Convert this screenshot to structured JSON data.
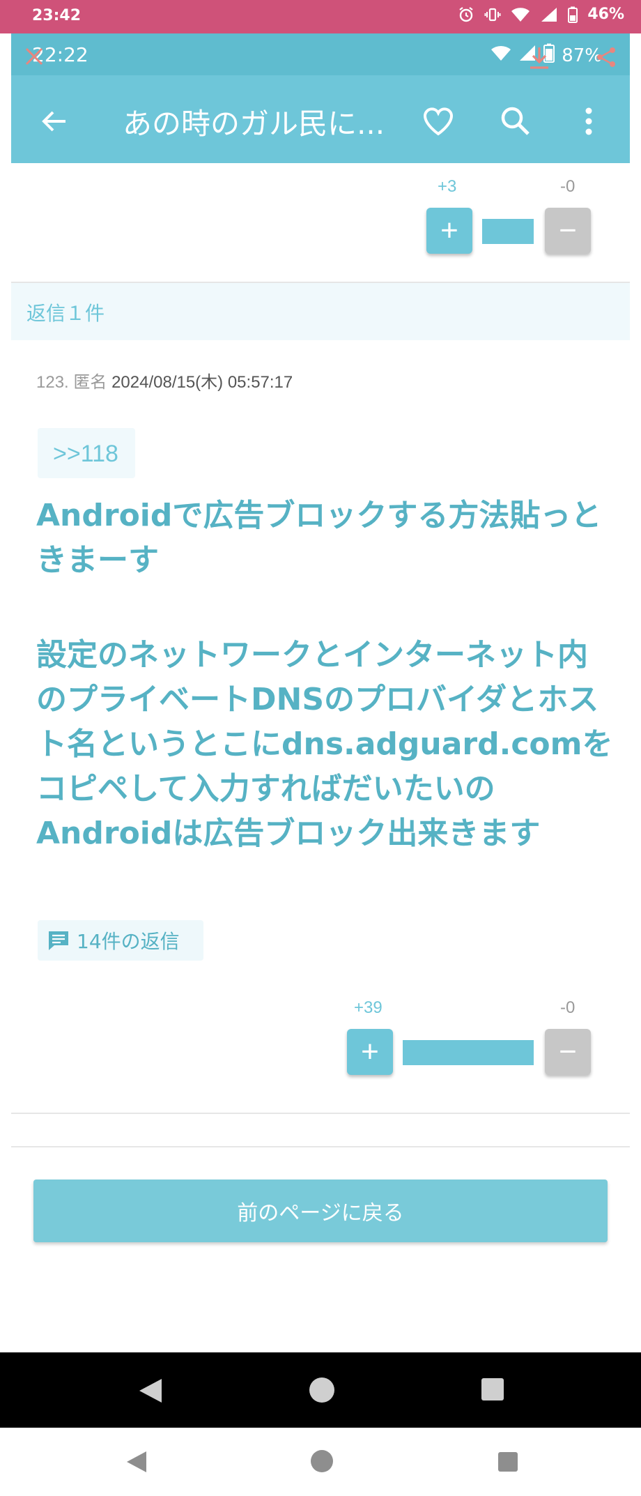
{
  "outer_status": {
    "time": "23:42",
    "battery": "46%"
  },
  "inner_status": {
    "time": "22:22",
    "battery": "87%"
  },
  "appbar": {
    "title": "あの時のガル民に..."
  },
  "prev_vote": {
    "plus_count": "+3",
    "minus_count": "-0",
    "plus_label": "+",
    "minus_label": "−",
    "ratio": 1.0
  },
  "reply_header": {
    "label": "返信１件"
  },
  "comment": {
    "number": "123.",
    "author": "匿名",
    "date": "2024/08/15(木) 05:57:17",
    "anchor": ">>118",
    "paragraph1": "Androidで広告ブロックする方法貼っときまーす",
    "paragraph2": "設定のネットワークとインターネット内のプライベートDNSのプロバイダとホスト名というとこにdns.adguard.comをコピペして入力すればだいたいのAndroidは広告ブロック出来きます",
    "replies_label": "14件の返信",
    "plus_count": "+39",
    "minus_count": "-0",
    "plus_label": "+",
    "minus_label": "−",
    "ratio": 1.0
  },
  "prev_page_button": {
    "label": "前のページに戻る"
  },
  "colors": {
    "accent": "#6ec6d9",
    "text_accent": "#56b2c4",
    "outer_status_bar": "#cf5279"
  }
}
